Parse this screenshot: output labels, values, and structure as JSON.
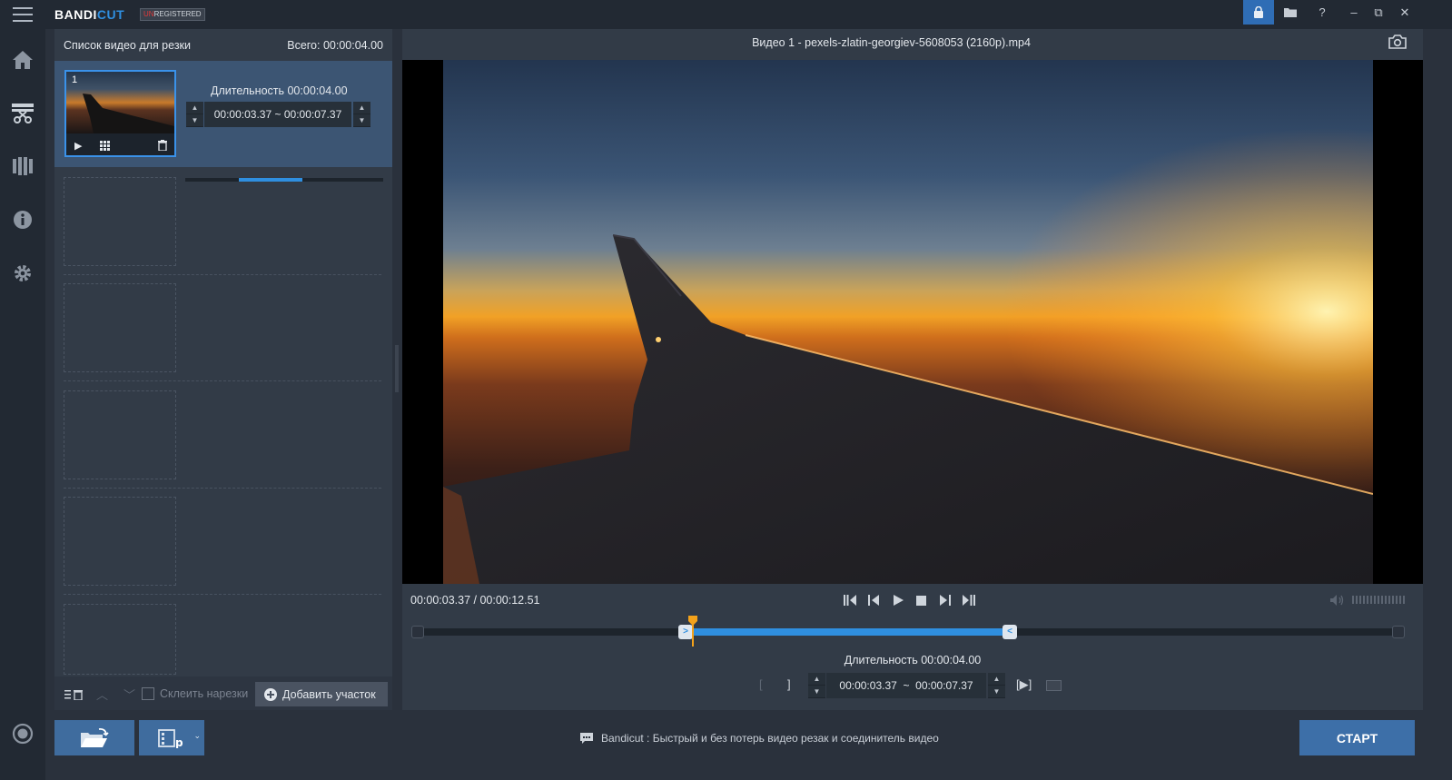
{
  "app": {
    "logo_main": "BANDI",
    "logo_accent": "CUT",
    "badge_un": "UN",
    "badge_rest": "REGISTERED",
    "accent_color": "#2f8fe0"
  },
  "window_controls": {
    "help": "?",
    "minimize": "–",
    "maximize": "⧉",
    "close": "✕"
  },
  "nav": {
    "items": [
      "home-icon",
      "cut-icon",
      "film-icon",
      "info-icon",
      "gear-icon"
    ],
    "record": "record-icon"
  },
  "list_panel": {
    "title": "Список видео для резки",
    "total": "Всего: 00:00:04.00",
    "item": {
      "number": "1",
      "duration": "Длительность 00:00:04.00",
      "start": "00:00:03.37",
      "sep": "~",
      "end": "00:00:07.37",
      "range_fraction": [
        0.27,
        0.59
      ]
    },
    "footer": {
      "merge_label": "Склеить нарезки",
      "add_label": "Добавить участок"
    }
  },
  "player": {
    "title": "Видео 1 - pexels-zlatin-georgiev-5608053 (2160p).mp4",
    "current_time": "00:00:03.37",
    "time_sep": " / ",
    "total_time": "00:00:12.51",
    "duration": "Длительность 00:00:04.00",
    "seg_start": "00:00:03.37",
    "seg_sep": "~",
    "seg_end": "00:00:07.37",
    "bracket_open": "[",
    "bracket_close": "]",
    "play_segment": "[▶]"
  },
  "status": {
    "text": "Bandicut : Быстрый и без потерь видео резак и соединитель видео"
  },
  "start_label": "СТАРТ"
}
